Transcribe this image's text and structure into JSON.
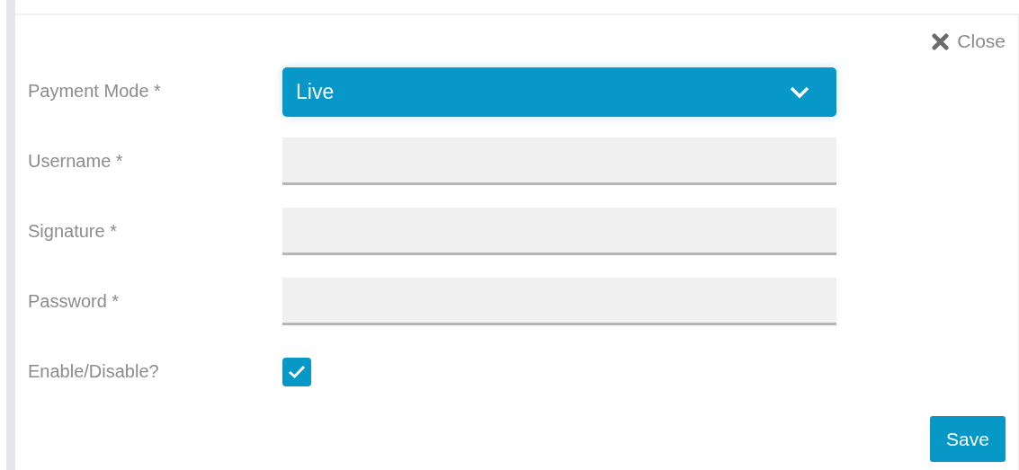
{
  "close": {
    "label": "Close"
  },
  "fields": [
    {
      "kind": "select",
      "label": "Payment Mode *",
      "value": "Live"
    },
    {
      "kind": "text",
      "label": "Username *"
    },
    {
      "kind": "text",
      "label": "Signature *"
    },
    {
      "kind": "text",
      "label": "Password *"
    },
    {
      "kind": "checkbox",
      "label": "Enable/Disable?",
      "checked": true
    }
  ],
  "save": {
    "label": "Save"
  }
}
